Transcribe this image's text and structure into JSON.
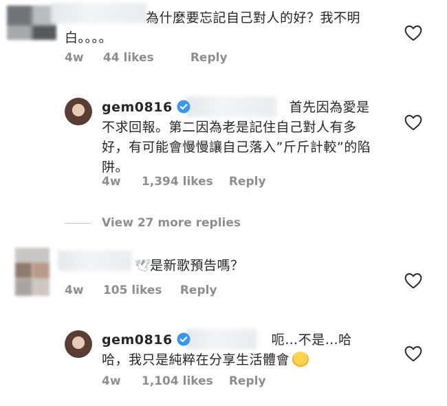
{
  "comments": [
    {
      "text": "為什麼要忘記自己對人的好？我不明白。。。。",
      "time": "4w",
      "likes": "44 likes",
      "reply": "Reply"
    },
    {
      "username": "gem0816",
      "text": "首先因為愛是不求回報。第二因為老是記住自己對人有多好，有可能會慢慢讓自己落入”斤斤計較”的陷阱。",
      "time": "4w",
      "likes": "1,394 likes",
      "reply": "Reply"
    },
    {
      "text": "是新歌預告嗎？",
      "time": "4w",
      "likes": "105 likes",
      "reply": "Reply"
    },
    {
      "username": "gem0816",
      "text": "呃…不是…哈哈，我只是純粹在分享生活體會",
      "time": "4w",
      "likes": "1,104 likes",
      "reply": "Reply"
    }
  ],
  "view_more": "View 27 more replies",
  "icons": {
    "heart": "heart-outline-icon",
    "verified": "verified-badge-icon",
    "bird": "dove-emoji-icon",
    "hug": "hugging-face-emoji-icon"
  },
  "colors": {
    "text": "#262626",
    "meta": "#8e8e8e",
    "verified": "#3897f0"
  }
}
